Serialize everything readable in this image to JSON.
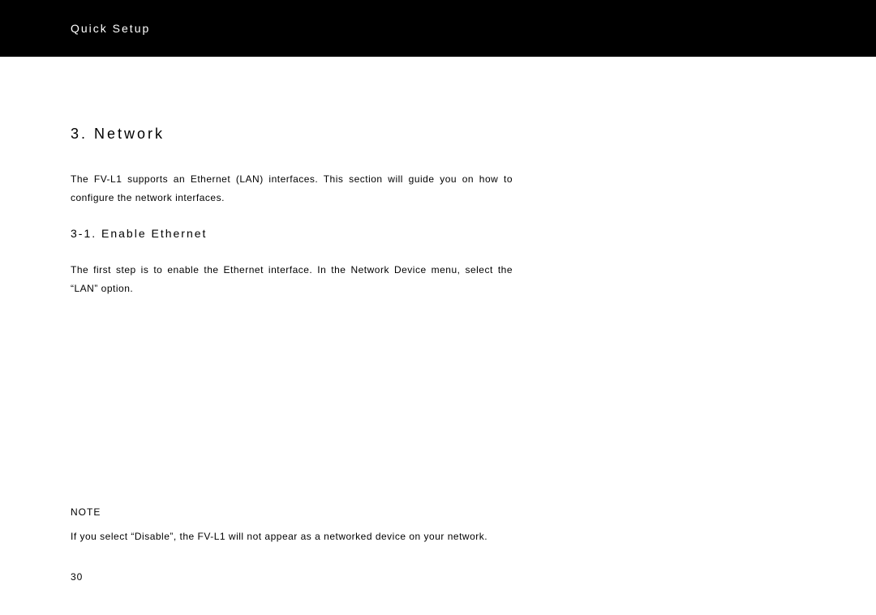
{
  "header": {
    "title": "Quick Setup"
  },
  "section": {
    "heading": "3. Network",
    "intro": "The FV-L1 supports an Ethernet (LAN) interfaces.  This section will guide you on how to configure the network interfaces."
  },
  "subsection": {
    "heading": "3-1. Enable Ethernet",
    "text": "The first step is to enable the Ethernet interface.  In the Network Device menu, select the “LAN” option."
  },
  "note": {
    "label": "NOTE",
    "text": "If you select “Disable”, the FV-L1 will not appear as a networked device on your network."
  },
  "page_number": "30"
}
